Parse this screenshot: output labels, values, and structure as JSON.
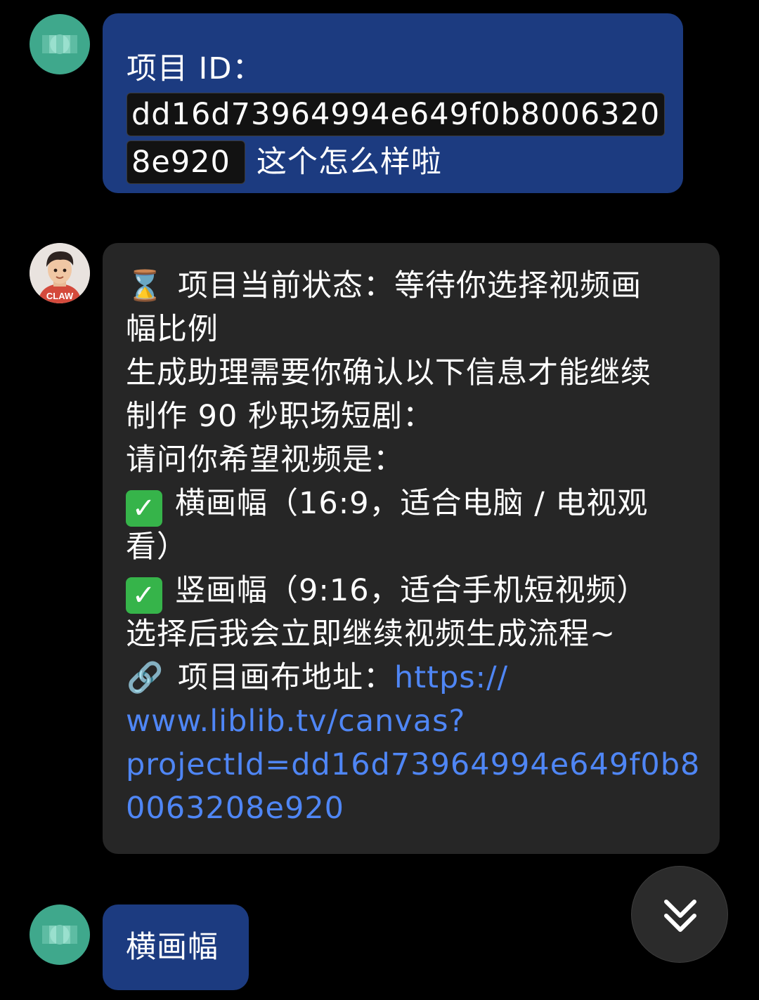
{
  "messages": {
    "m1": {
      "line1": "项目 ID：",
      "code_part1": "dd16d73964994e649f0b8006320",
      "code_part2": "8e920",
      "tail": "这个怎么样啦"
    },
    "m2": {
      "status_icon": "⌛",
      "status_line_a": "项目当前状态：等待你选择视频画",
      "status_line_b": "幅比例",
      "body1_a": "生成助理需要你确认以下信息才能继续",
      "body1_b": "制作 90 秒职场短剧：",
      "question": "请问你希望视频是：",
      "check_glyph": "✓",
      "option1_a": "横画幅（16:9，适合电脑 / 电视观",
      "option1_b": "看）",
      "option2": "竖画幅（9:16，适合手机短视频）",
      "after": "选择后我会立即继续视频生成流程~",
      "link_icon": "🔗",
      "link_label": "项目画布地址：",
      "url_a": "https://",
      "url_b": "www.liblib.tv/canvas?",
      "url_c": "projectId=dd16d73964994e649f0b8",
      "url_d": "0063208e920"
    },
    "m3": {
      "text": "横画幅"
    }
  },
  "bot_avatar_badge": "CLAW",
  "scroll_icon": "chevron-double-down-icon",
  "colors": {
    "background": "#000000",
    "my_bubble": "#1c3b80",
    "bot_bubble": "#262626",
    "link": "#4f86f5",
    "check": "#36b44a"
  }
}
